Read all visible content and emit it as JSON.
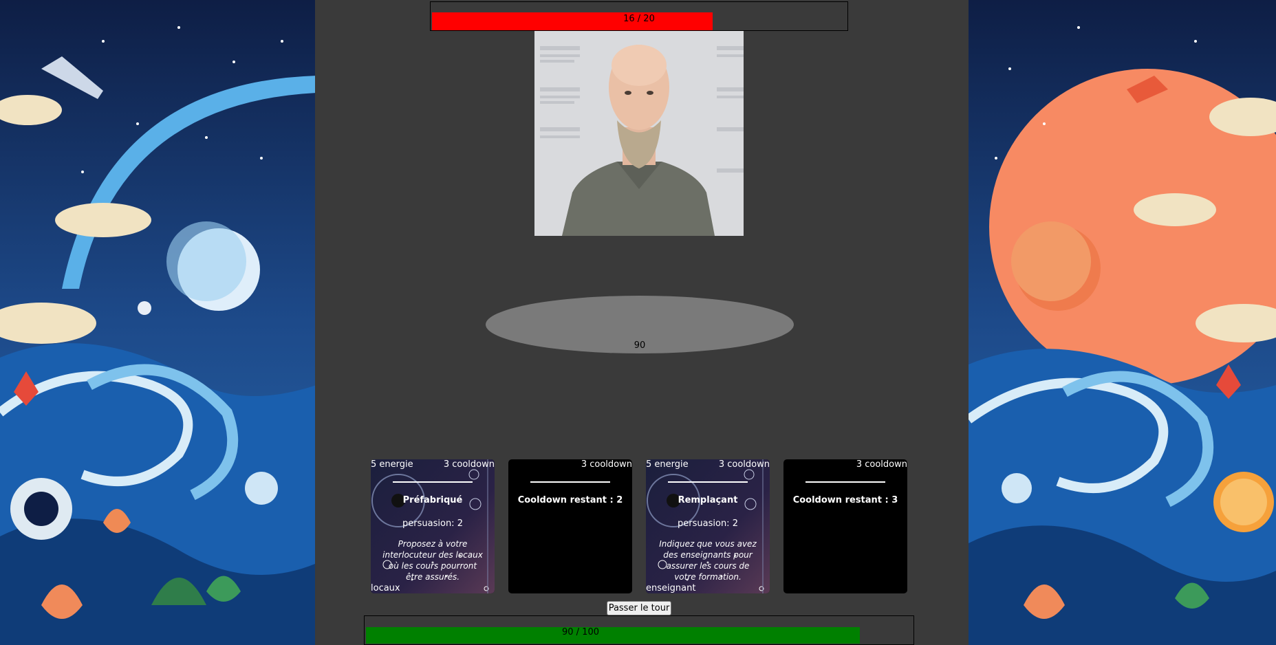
{
  "enemy": {
    "hp_text": "16 / 20",
    "hp_fraction": 0.8,
    "bar_color": "#ff0000"
  },
  "arena": {
    "value": "90"
  },
  "cards": [
    {
      "energy": "5 energie",
      "cooldown": "3 cooldown",
      "title": "Préfabriqué",
      "stat": "persuasion: 2",
      "description": "Proposez à votre interlocuteur des locaux où les cours pourront être assurés.",
      "tag": "locaux",
      "available": true
    },
    {
      "energy": "",
      "cooldown": "3 cooldown",
      "title": "Cooldown restant : 2",
      "stat": "",
      "description": "",
      "tag": "",
      "available": false
    },
    {
      "energy": "5 energie",
      "cooldown": "3 cooldown",
      "title": "Remplaçant",
      "stat": "persuasion: 2",
      "description": "Indiquez que vous avez des enseignants pour assurer les cours de votre formation.",
      "tag": "enseignant",
      "available": true
    },
    {
      "energy": "",
      "cooldown": "3 cooldown",
      "title": "Cooldown restant : 3",
      "stat": "",
      "description": "",
      "tag": "",
      "available": false
    }
  ],
  "pass_button": {
    "label": "Passer le tour"
  },
  "player": {
    "energy_text": "90 / 100",
    "energy_fraction": 0.9,
    "bar_color": "#008000"
  }
}
